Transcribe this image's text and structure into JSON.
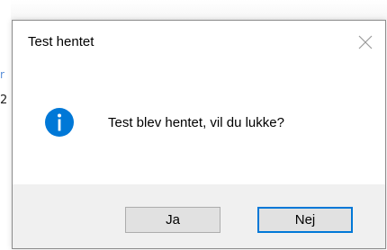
{
  "background": {
    "fragment_top": "r",
    "fragment_bottom": "2"
  },
  "dialog": {
    "title": "Test hentet",
    "close_icon": "close-icon",
    "icon": "info-icon",
    "message": "Test blev hentet, vil du lukke?",
    "buttons": {
      "yes_label": "Ja",
      "no_label": "Nej"
    },
    "colors": {
      "info_icon": "#0078d7",
      "default_button_border": "#0078d7",
      "footer_background": "#f0f0f0",
      "button_background": "#e1e1e1"
    }
  }
}
